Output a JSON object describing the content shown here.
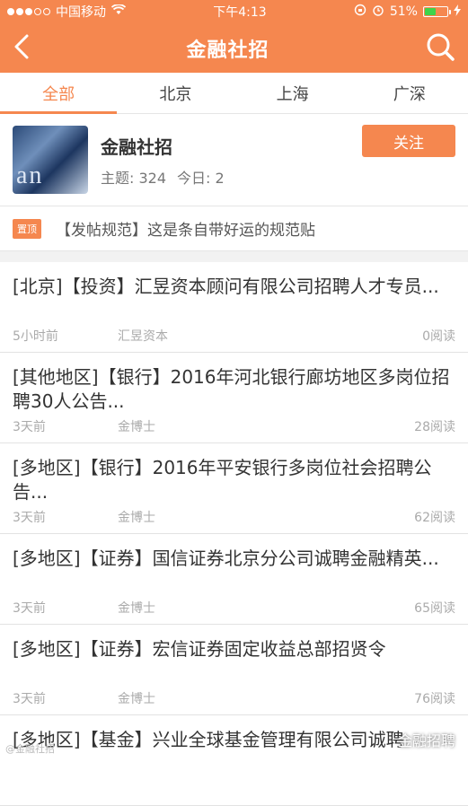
{
  "status_bar": {
    "carrier": "中国移动",
    "time": "下午4:13",
    "battery": "51%",
    "battery_level": 0.51
  },
  "nav": {
    "title": "金融社招",
    "back_icon": "back-arrow-icon",
    "search_icon": "search-icon"
  },
  "tabs": [
    {
      "label": "全部",
      "active": true
    },
    {
      "label": "北京",
      "active": false
    },
    {
      "label": "上海",
      "active": false
    },
    {
      "label": "广深",
      "active": false
    }
  ],
  "forum": {
    "name": "金融社招",
    "topics_label": "主题: 324",
    "today_label": "今日: 2",
    "follow_label": "关注",
    "thumb_text": "an"
  },
  "pinned": {
    "badge": "置顶",
    "text": "【发帖规范】这是条自带好运的规范贴"
  },
  "posts": [
    {
      "title": "[北京]【投资】汇昱资本顾问有限公司招聘人才专员...",
      "time": "5小时前",
      "author": "汇昱资本",
      "reads": "0阅读"
    },
    {
      "title": "[其他地区]【银行】2016年河北银行廊坊地区多岗位招聘30人公告...",
      "time": "3天前",
      "author": "金博士",
      "reads": "28阅读"
    },
    {
      "title": "[多地区]【银行】2016年平安银行多岗位社会招聘公告...",
      "time": "3天前",
      "author": "金博士",
      "reads": "62阅读"
    },
    {
      "title": "[多地区]【证券】国信证券北京分公司诚聘金融精英...",
      "time": "3天前",
      "author": "金博士",
      "reads": "65阅读"
    },
    {
      "title": "[多地区]【证券】宏信证券固定收益总部招贤令",
      "time": "3天前",
      "author": "金博士",
      "reads": "76阅读"
    },
    {
      "title": "[多地区]【基金】兴业全球基金管理有限公司诚聘",
      "time": "",
      "author": "",
      "reads": ""
    }
  ],
  "watermark": {
    "left": "@金融社招",
    "right": "金融招聘"
  },
  "colors": {
    "accent": "#f5874f",
    "battery_green": "#3fd34a"
  }
}
